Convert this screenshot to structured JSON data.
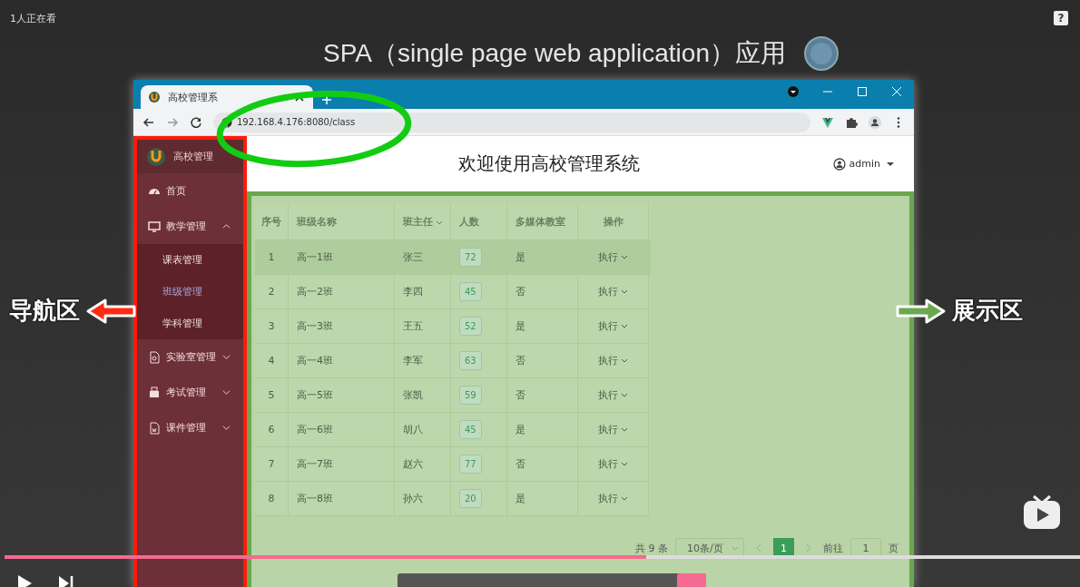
{
  "player": {
    "viewers": "1人正在看",
    "help": "?",
    "slide_title": "SPA（single page web application）应用",
    "progress": {
      "level": 0.597
    }
  },
  "browser": {
    "tab_title": "高校管理系",
    "url": "192.168.4.176:8080/class"
  },
  "app": {
    "brand": "高校管理",
    "menu": [
      {
        "label": "首页",
        "kind": "link"
      },
      {
        "label": "教学管理",
        "kind": "submenu",
        "expanded": true,
        "children": [
          {
            "label": "课表管理",
            "selected": false
          },
          {
            "label": "班级管理",
            "selected": true
          },
          {
            "label": "学科管理",
            "selected": false
          }
        ]
      },
      {
        "label": "实验室管理",
        "kind": "submenu",
        "expanded": false
      },
      {
        "label": "考试管理",
        "kind": "submenu",
        "expanded": false
      },
      {
        "label": "课件管理",
        "kind": "submenu",
        "expanded": false
      }
    ],
    "header_title": "欢迎使用高校管理系统",
    "user": "admin"
  },
  "table": {
    "columns": [
      {
        "label": "序号",
        "kind": "index",
        "filter": false
      },
      {
        "label": "班级名称",
        "kind": "text",
        "filter": false
      },
      {
        "label": "班主任",
        "kind": "text",
        "filter": true
      },
      {
        "label": "人数",
        "kind": "tag",
        "filter": false
      },
      {
        "label": "多媒体教室",
        "kind": "text",
        "filter": false
      },
      {
        "label": "操作",
        "kind": "action",
        "filter": false
      }
    ],
    "rows": [
      {
        "highlighted": true,
        "cells": [
          "1",
          "高一1班",
          "张三",
          "72",
          "是",
          "执行"
        ]
      },
      {
        "highlighted": false,
        "cells": [
          "2",
          "高一2班",
          "李四",
          "45",
          "否",
          "执行"
        ]
      },
      {
        "highlighted": false,
        "cells": [
          "3",
          "高一3班",
          "王五",
          "52",
          "是",
          "执行"
        ]
      },
      {
        "highlighted": false,
        "cells": [
          "4",
          "高一4班",
          "李军",
          "63",
          "否",
          "执行"
        ]
      },
      {
        "highlighted": false,
        "cells": [
          "5",
          "高一5班",
          "张凯",
          "59",
          "否",
          "执行"
        ]
      },
      {
        "highlighted": false,
        "cells": [
          "6",
          "高一6班",
          "胡八",
          "45",
          "是",
          "执行"
        ]
      },
      {
        "highlighted": false,
        "cells": [
          "7",
          "高一7班",
          "赵六",
          "77",
          "否",
          "执行"
        ]
      },
      {
        "highlighted": false,
        "cells": [
          "8",
          "高一8班",
          "孙六",
          "20",
          "是",
          "执行"
        ]
      }
    ]
  },
  "pagination": {
    "total": "共 9 条",
    "page_size": "10条/页",
    "pages": [
      {
        "label": "1",
        "selected": true
      }
    ],
    "goto_label": "前往",
    "goto_value": "1",
    "goto_suffix": "页"
  },
  "annotations": [
    {
      "label": "导航区",
      "kind": "left-arrow",
      "color": "#ff2a14"
    },
    {
      "label": "展示区",
      "kind": "right-arrow",
      "color": "#6aa84f"
    }
  ]
}
